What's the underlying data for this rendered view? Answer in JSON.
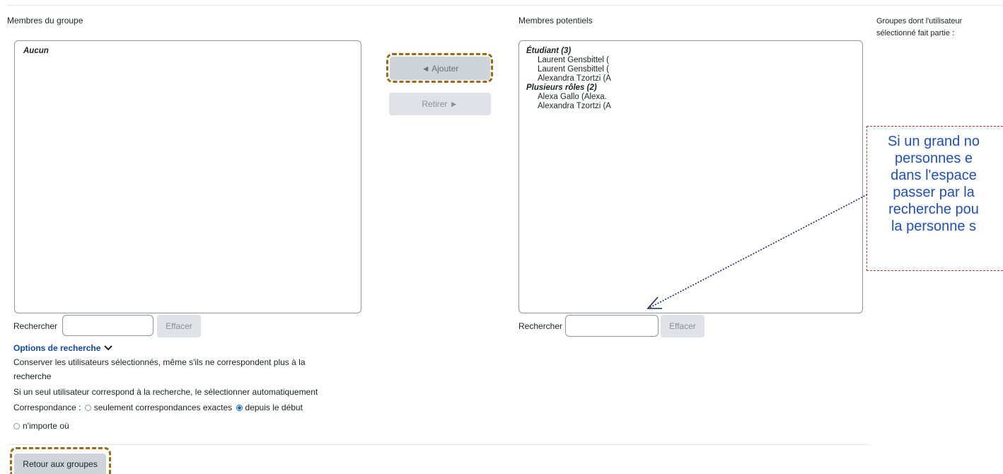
{
  "members": {
    "title": "Membres du groupe",
    "empty_label": "Aucun"
  },
  "buttons": {
    "add": "◄ Ajouter",
    "remove": "Retirer ►",
    "back": "Retour aux groupes"
  },
  "potential": {
    "title": "Membres potentiels",
    "groups": [
      {
        "label": "Étudiant (3)",
        "items": [
          "Laurent Gensbittel (",
          "Laurent Gensbittel (",
          "Alexandra Tzortzi (A"
        ]
      },
      {
        "label": "Plusieurs rôles (2)",
        "items": [
          "Alexa Gallo (Alexa.",
          "Alexandra Tzortzi (A"
        ]
      }
    ]
  },
  "user_groups": {
    "title_line1": "Groupes dont l'utilisateur",
    "title_line2": "sélectionné fait partie :"
  },
  "search": {
    "label": "Rechercher",
    "clear": "Effacer",
    "value": ""
  },
  "options": {
    "toggle_label": "Options de recherche",
    "keep_selected_line1": "Conserver les utilisateurs sélectionnés, même s'ils ne correspondent plus à la",
    "keep_selected_line2": "recherche",
    "auto_select": "Si un seul utilisateur correspond à la recherche, le sélectionner automatiquement",
    "match_label": "Correspondance :",
    "match_exact": "seulement correspondances exactes",
    "match_start": "depuis le début",
    "match_anywhere": "n'importe où",
    "selected_match": "depuis le début"
  },
  "annotation": {
    "lines": [
      "Si un grand no",
      "personnes e",
      "dans l'espace",
      "passer par la",
      "recherche pou",
      "la personne s"
    ]
  },
  "colors": {
    "link": "#0f47ad",
    "annotation_text": "#1f4fbf",
    "annotation_border": "#c0392b",
    "highlight_border": "#9c6b12",
    "arrow": "#1a2a66"
  }
}
